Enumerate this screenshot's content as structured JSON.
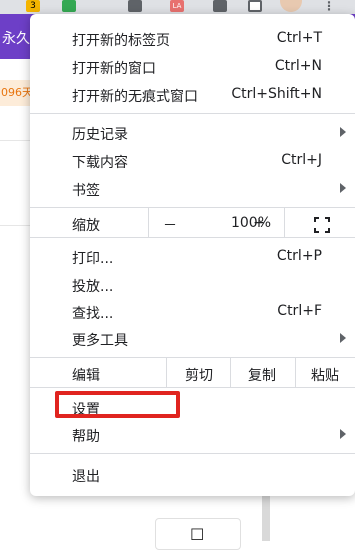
{
  "topbar": {
    "badge_count": "3",
    "ext_label": "LA",
    "more_icon": "⋮"
  },
  "background": {
    "purple_text": "永久",
    "orange_text": "096天"
  },
  "menu": {
    "new_tab": {
      "label": "打开新的标签页",
      "shortcut": "Ctrl+T"
    },
    "new_window": {
      "label": "打开新的窗口",
      "shortcut": "Ctrl+N"
    },
    "new_incognito": {
      "label": "打开新的无痕式窗口",
      "shortcut": "Ctrl+Shift+N"
    },
    "history": {
      "label": "历史记录"
    },
    "downloads": {
      "label": "下载内容",
      "shortcut": "Ctrl+J"
    },
    "bookmarks": {
      "label": "书签"
    },
    "zoom": {
      "label": "缩放",
      "minus": "－",
      "value": "100%",
      "plus": "+"
    },
    "print": {
      "label": "打印...",
      "shortcut": "Ctrl+P"
    },
    "cast": {
      "label": "投放..."
    },
    "find": {
      "label": "查找...",
      "shortcut": "Ctrl+F"
    },
    "more_tools": {
      "label": "更多工具"
    },
    "edit": {
      "label": "编辑",
      "cut": "剪切",
      "copy": "复制",
      "paste": "粘贴"
    },
    "settings": {
      "label": "设置"
    },
    "help": {
      "label": "帮助"
    },
    "exit": {
      "label": "退出"
    }
  },
  "background_card": {
    "glyph": "☐"
  },
  "colors": {
    "highlight": "#e0241f",
    "accent_purple": "#6d3fc7"
  }
}
